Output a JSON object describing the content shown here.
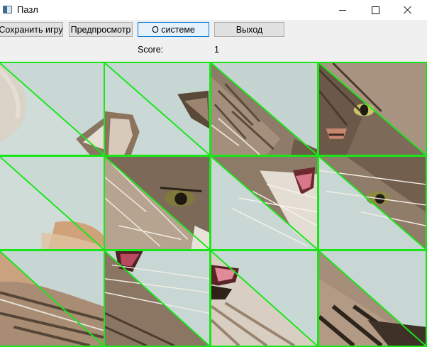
{
  "window": {
    "title": "Пазл",
    "icon": "app-window-icon"
  },
  "toolbar": {
    "save_label": "Сохранить игру",
    "preview_label": "Предпросмотр",
    "about_label": "О системе",
    "exit_label": "Выход"
  },
  "score": {
    "label": "Score:",
    "value": "1"
  },
  "colors": {
    "tile_border": "#19e619",
    "background": "#f0f0f0",
    "focus_border": "#0078d7"
  },
  "board": {
    "rows": 3,
    "columns": 4,
    "tiles": [
      {
        "content": "fur-edge-left"
      },
      {
        "content": "cat-ear"
      },
      {
        "content": "cat-head-top"
      },
      {
        "content": "cat-eye-nose"
      },
      {
        "content": "background-fur"
      },
      {
        "content": "cat-eye"
      },
      {
        "content": "cat-mouth"
      },
      {
        "content": "cat-eye-right"
      },
      {
        "content": "whiskers-fur"
      },
      {
        "content": "cat-mouth-corner"
      },
      {
        "content": "cat-chin"
      },
      {
        "content": "fur-bottom-right"
      }
    ]
  }
}
